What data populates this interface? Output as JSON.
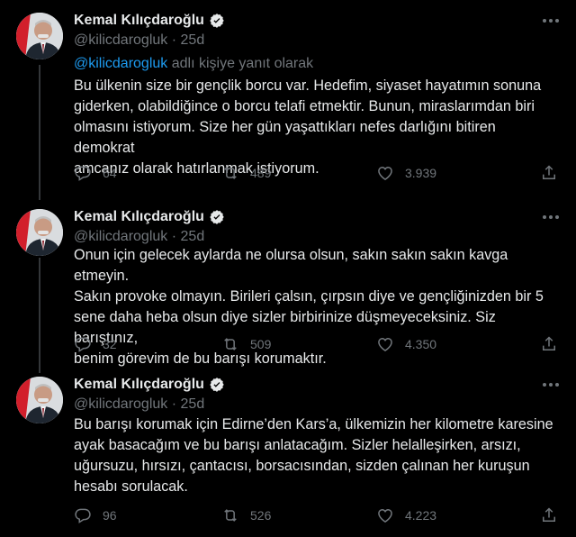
{
  "tweets": [
    {
      "name": "Kemal Kılıçdaroğlu",
      "handle": "@kilicdarogluk",
      "sep": "·",
      "time": "25d",
      "replying_mention": "@kilicdarogluk",
      "replying_suffix": "adlı kişiye yanıt olarak",
      "lines": [
        "Bu ülkenin size bir gençlik borcu var. Hedefim, siyaset hayatımın sonuna",
        "giderken, olabildiğince o borcu telafi etmektir. Bunun, miraslarımdan biri",
        "olmasını istiyorum. Size her gün yaşattıkları nefes darlığını bitiren demokrat",
        "amcanız olarak hatırlanmak istiyorum."
      ],
      "replies": "64",
      "retweets": "489",
      "likes": "3.939"
    },
    {
      "name": "Kemal Kılıçdaroğlu",
      "handle": "@kilicdarogluk",
      "sep": "·",
      "time": "25d",
      "lines": [
        "Onun için gelecek aylarda ne olursa olsun, sakın sakın sakın kavga etmeyin.",
        "Sakın provoke olmayın. Birileri çalsın, çırpsın diye ve gençliğinizden bir 5",
        "sene daha heba olsun diye sizler birbirinize düşmeyeceksiniz. Siz barıştınız,",
        "benim görevim de bu barışı korumaktır."
      ],
      "replies": "32",
      "retweets": "509",
      "likes": "4.350"
    },
    {
      "name": "Kemal Kılıçdaroğlu",
      "handle": "@kilicdarogluk",
      "sep": "·",
      "time": "25d",
      "lines": [
        "Bu barışı korumak için Edirne’den Kars’a, ülkemizin her kilometre karesine",
        "ayak basacağım ve bu barışı anlatacağım. Sizler helalleşirken, arsızı,",
        "uğursuzu, hırsızı, çantacısı, borsacısından, sizden çalınan her kuruşun",
        "hesabı sorulacak."
      ],
      "replies": "96",
      "retweets": "526",
      "likes": "4.223"
    }
  ],
  "icons": {
    "verified": "verified-badge-icon",
    "more": "more-options-icon",
    "reply": "reply-icon",
    "retweet": "retweet-icon",
    "like": "like-icon",
    "share": "share-icon"
  },
  "colors": {
    "background": "#000000",
    "text": "#e7e9ea",
    "secondary": "#71767b",
    "accent": "#1d9bf0"
  }
}
